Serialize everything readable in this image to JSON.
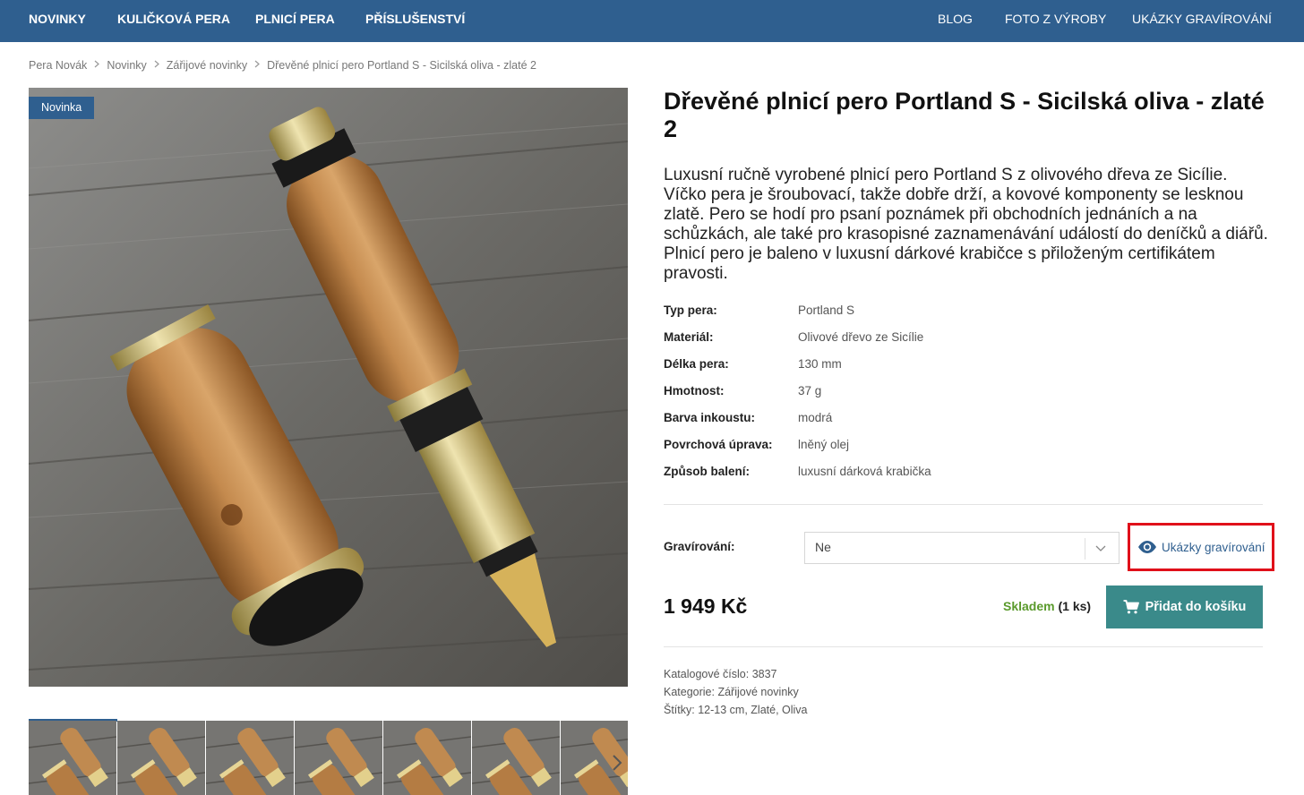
{
  "nav": {
    "left": [
      "NOVINKY",
      "KULIČKOVÁ PERA",
      "PLNICÍ PERA",
      "PŘÍSLUŠENSTVÍ"
    ],
    "right": [
      "BLOG",
      "FOTO Z VÝROBY",
      "UKÁZKY GRAVÍROVÁNÍ"
    ]
  },
  "breadcrumb": {
    "items": [
      "Pera Novák",
      "Novinky",
      "Zářijové novinky"
    ],
    "current": "Dřevěné plnicí pero Portland S - Sicilská oliva - zlaté 2"
  },
  "gallery": {
    "badge": "Novinka",
    "thumb_count": 7
  },
  "product": {
    "title": "Dřevěné plnicí pero Portland S - Sicilská oliva - zlaté 2",
    "description": "Luxusní ručně vyrobené plnicí pero Portland S z olivového dřeva ze Sicílie. Víčko pera je šroubovací, takže dobře drží, a kovové komponenty se lesknou zlatě. Pero se hodí pro psaní poznámek při obchodních jednáních a na schůzkách, ale také pro krasopisné zaznamenávání událostí do deníčků a diářů. Plnicí pero je baleno v luxusní dárkové krabičce s přiloženým certifikátem pravosti.",
    "specs": [
      {
        "label": "Typ pera:",
        "value": "Portland S"
      },
      {
        "label": "Materiál:",
        "value": "Olivové dřevo ze Sicílie"
      },
      {
        "label": "Délka pera:",
        "value": "130 mm"
      },
      {
        "label": "Hmotnost:",
        "value": "37 g"
      },
      {
        "label": "Barva inkoustu:",
        "value": "modrá"
      },
      {
        "label": "Povrchová úprava:",
        "value": "lněný olej"
      },
      {
        "label": "Způsob balení:",
        "value": "luxusní dárková krabička"
      }
    ],
    "engraving": {
      "label": "Gravírování:",
      "selected": "Ne",
      "samples_link": "Ukázky gravírování"
    },
    "price": "1 949 Kč",
    "stock": {
      "status": "Skladem",
      "qty": "(1 ks)"
    },
    "add_to_cart": "Přidat do košíku",
    "meta": {
      "catalog_label": "Katalogové číslo:",
      "catalog_value": "3837",
      "category_label": "Kategorie:",
      "category_value": "Zářijové novinky",
      "tags_label": "Štítky:",
      "tags": [
        "12-13 cm",
        "Zlaté",
        "Oliva"
      ]
    }
  },
  "colors": {
    "brand": "#2f5f8f",
    "cart": "#3a8a8a",
    "stock": "#5a9a2c",
    "highlight": "#e0101a"
  },
  "icons": {
    "breadcrumb_separator": "chevron-right-icon",
    "select": "chevron-down-icon",
    "engraving": "eye-icon",
    "cart": "cart-icon",
    "thumbs_next": "chevron-right-icon"
  }
}
